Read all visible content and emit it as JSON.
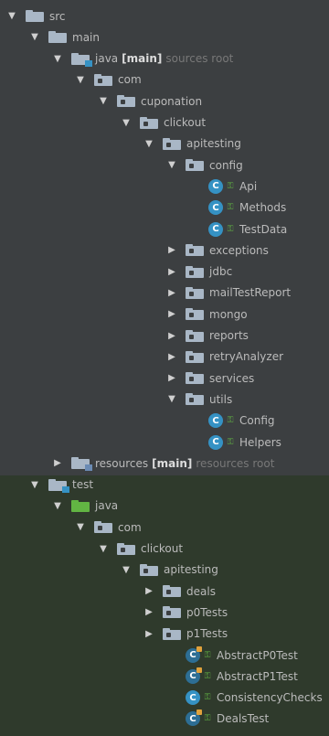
{
  "tree": [
    {
      "label": "src",
      "depth": 0,
      "arrow": "expanded",
      "icon": "folder"
    },
    {
      "label": "main",
      "depth": 1,
      "arrow": "expanded",
      "icon": "folder"
    },
    {
      "label": "java",
      "bold": "[main]",
      "hint": "sources root",
      "depth": 2,
      "arrow": "expanded",
      "icon": "source-root"
    },
    {
      "label": "com",
      "depth": 3,
      "arrow": "expanded",
      "icon": "package"
    },
    {
      "label": "cuponation",
      "depth": 4,
      "arrow": "expanded",
      "icon": "package"
    },
    {
      "label": "clickout",
      "depth": 5,
      "arrow": "expanded",
      "icon": "package"
    },
    {
      "label": "apitesting",
      "depth": 6,
      "arrow": "expanded",
      "icon": "package"
    },
    {
      "label": "config",
      "depth": 7,
      "arrow": "expanded",
      "icon": "package"
    },
    {
      "label": "Api",
      "depth": 8,
      "arrow": "none",
      "icon": "class"
    },
    {
      "label": "Methods",
      "depth": 8,
      "arrow": "none",
      "icon": "class"
    },
    {
      "label": "TestData",
      "depth": 8,
      "arrow": "none",
      "icon": "class"
    },
    {
      "label": "exceptions",
      "depth": 7,
      "arrow": "collapsed",
      "icon": "package"
    },
    {
      "label": "jdbc",
      "depth": 7,
      "arrow": "collapsed",
      "icon": "package"
    },
    {
      "label": "mailTestReport",
      "depth": 7,
      "arrow": "collapsed",
      "icon": "package"
    },
    {
      "label": "mongo",
      "depth": 7,
      "arrow": "collapsed",
      "icon": "package"
    },
    {
      "label": "reports",
      "depth": 7,
      "arrow": "collapsed",
      "icon": "package"
    },
    {
      "label": "retryAnalyzer",
      "depth": 7,
      "arrow": "collapsed",
      "icon": "package"
    },
    {
      "label": "services",
      "depth": 7,
      "arrow": "collapsed",
      "icon": "package"
    },
    {
      "label": "utils",
      "depth": 7,
      "arrow": "expanded",
      "icon": "package"
    },
    {
      "label": "Config",
      "depth": 8,
      "arrow": "none",
      "icon": "class"
    },
    {
      "label": "Helpers",
      "depth": 8,
      "arrow": "none",
      "icon": "class"
    },
    {
      "label": "resources",
      "bold": "[main]",
      "hint": "resources root",
      "depth": 2,
      "arrow": "collapsed",
      "icon": "resources-root"
    },
    {
      "label": "test",
      "depth": 1,
      "arrow": "expanded",
      "icon": "source-root"
    },
    {
      "label": "java",
      "depth": 2,
      "arrow": "expanded",
      "icon": "test-root"
    },
    {
      "label": "com",
      "depth": 3,
      "arrow": "expanded",
      "icon": "package"
    },
    {
      "label": "clickout",
      "depth": 4,
      "arrow": "expanded",
      "icon": "package"
    },
    {
      "label": "apitesting",
      "depth": 5,
      "arrow": "expanded",
      "icon": "package"
    },
    {
      "label": "deals",
      "depth": 6,
      "arrow": "collapsed",
      "icon": "package"
    },
    {
      "label": "p0Tests",
      "depth": 6,
      "arrow": "collapsed",
      "icon": "package"
    },
    {
      "label": "p1Tests",
      "depth": 6,
      "arrow": "collapsed",
      "icon": "package"
    },
    {
      "label": "AbstractP0Test",
      "depth": 7,
      "arrow": "none",
      "icon": "abstract-class"
    },
    {
      "label": "AbstractP1Test",
      "depth": 7,
      "arrow": "none",
      "icon": "abstract-class"
    },
    {
      "label": "ConsistencyChecks",
      "depth": 7,
      "arrow": "none",
      "icon": "class"
    },
    {
      "label": "DealsTest",
      "depth": 7,
      "arrow": "none",
      "icon": "abstract-class"
    }
  ],
  "icons": {
    "expanded": "▼",
    "collapsed": "▶",
    "class_letter": "C",
    "lock": "🔓"
  },
  "colors": {
    "background": "#3c3f41",
    "test_background": "#2f3a2c",
    "text": "#bbbbbb",
    "folder": "#a9b7c6",
    "class_badge": "#3592c4",
    "test_folder": "#62b543",
    "hint": "#787878"
  }
}
